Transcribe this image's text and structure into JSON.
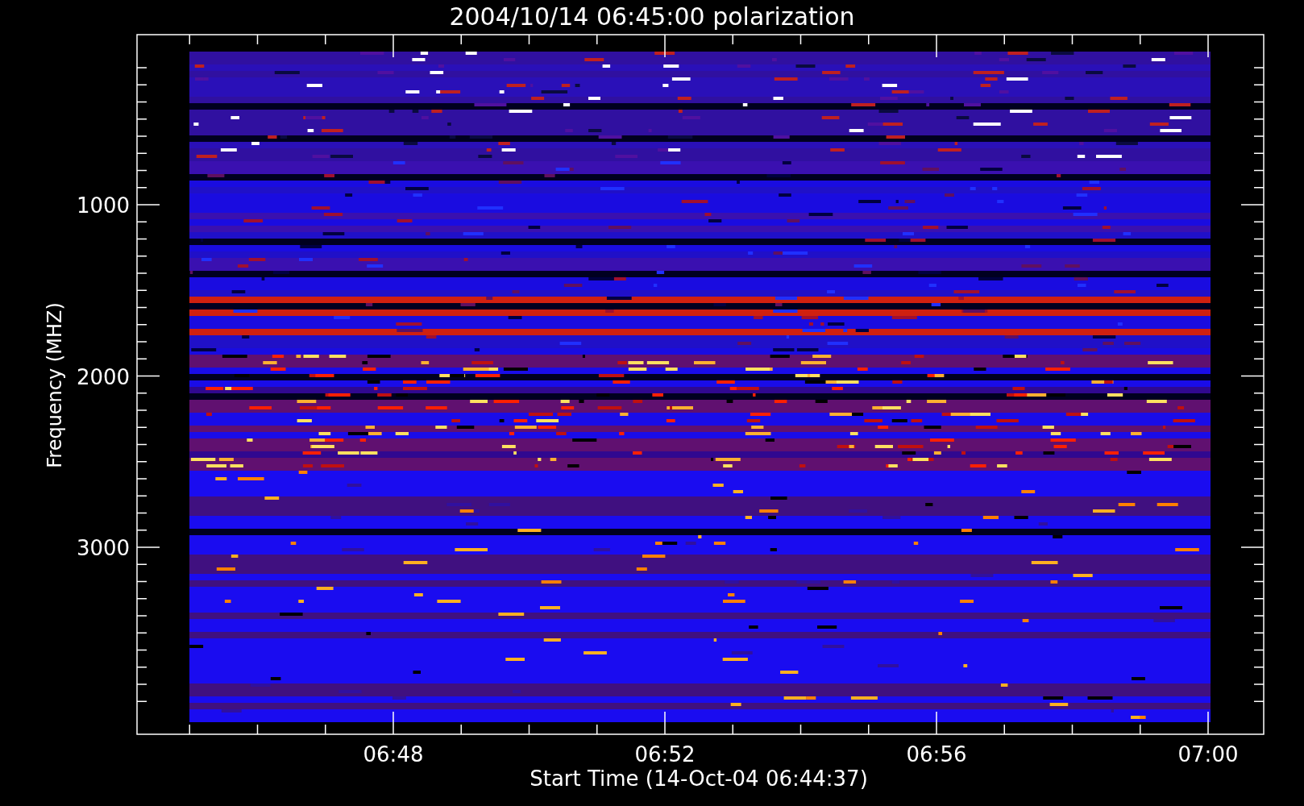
{
  "plot": {
    "title": "2004/10/14 06:45:00 polarization",
    "ylabel": "Frequency (MHZ)",
    "xlabel": "Start Time (14-Oct-04 06:44:37)",
    "y_tick_labels": [
      "1000",
      "2000",
      "3000"
    ],
    "x_tick_labels": [
      "06:48",
      "06:52",
      "06:56",
      "07:00"
    ]
  }
}
